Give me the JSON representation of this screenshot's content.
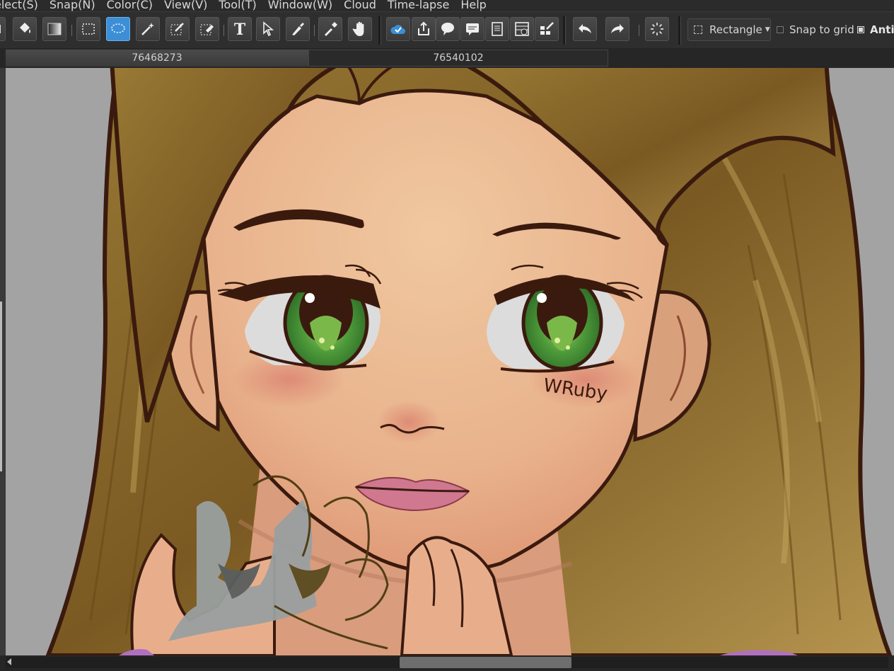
{
  "menu": [
    "elect(S)",
    "Snap(N)",
    "Color(C)",
    "View(V)",
    "Tool(T)",
    "Window(W)",
    "Cloud",
    "Time-lapse",
    "Help"
  ],
  "toolbar": {
    "shape_label": "Rectangle",
    "snap_label": "Snap to grid",
    "anti_label": "AntiA"
  },
  "tabs": [
    "76468273",
    "76540102"
  ],
  "artwork": {
    "signature": "WRuby"
  },
  "colors": {
    "active_tool": "#3c8fd6",
    "canvas_bg": "#a3a3a3",
    "hair": "#8a6a2a",
    "skin": "#ecb993",
    "iris": "#3f8c32",
    "lips": "#d07890",
    "outline": "#3b1a0e"
  }
}
